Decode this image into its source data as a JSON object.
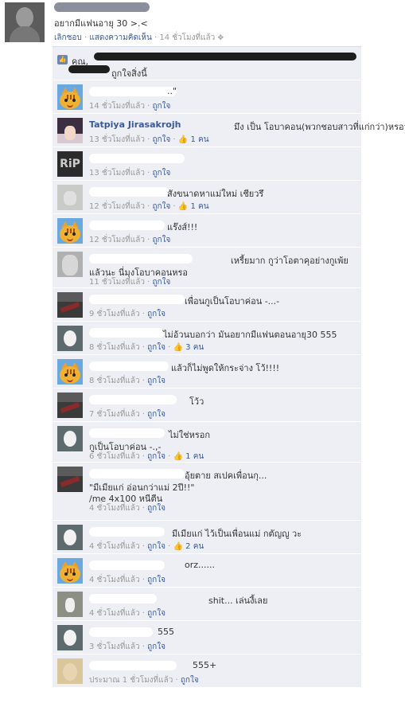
{
  "post": {
    "text": "อยากมีแฟนอายุ 30 >.<",
    "unlike": "เลิกชอบ",
    "comment": "แสดงความคิดเห็น",
    "time": "14 ชั่วโมงที่แล้ว",
    "sep": "·"
  },
  "likes": {
    "you": "คุณ,",
    "tail": "ถูกใจสิ่งนี้"
  },
  "comment_like_label": "ถูกใจ",
  "comments": [
    {
      "avatar": "cat",
      "name": "",
      "text": "..\"",
      "text2": "",
      "time": "14 ชั่วโมงที่แล้ว",
      "likes": ""
    },
    {
      "avatar": "anime",
      "name": "Tatpiya Jirasakrojh",
      "text": "มึง เป็น โอบาคอน(พวกชอบสาวที่แก่กว่า)หรอวะ",
      "text2": "",
      "time": "13 ชั่วโมงที่แล้ว",
      "likes": "1 คน"
    },
    {
      "avatar": "rip",
      "name": "",
      "text": "",
      "text2": "",
      "time": "13 ชั่วโมงที่แล้ว",
      "likes": ""
    },
    {
      "avatar": "sticker",
      "name": "",
      "text": "สังขนาดหาแม่ใหม่ เชียวรึ",
      "text2": "",
      "time": "12 ชั่วโมงที่แล้ว",
      "likes": "1 คน"
    },
    {
      "avatar": "cat",
      "name": "",
      "text": "แร๊งส์!!!",
      "text2": "",
      "time": "12 ชั่วโมงที่แล้ว",
      "likes": ""
    },
    {
      "avatar": "gray",
      "name": "",
      "text": "เหรี้ยมาก กูว่าโอตาคุอย่างกูเพ้ย",
      "text2": "แล้วนะ นี่มุงโอบาคอนหรอ",
      "time": "11 ชั่วโมงที่แล้ว",
      "likes": ""
    },
    {
      "avatar": "guitar",
      "name": "",
      "text": "เพื่อนกูเป็นโอบาค่อน -...-",
      "text2": "",
      "time": "9 ชั่วโมงที่แล้ว",
      "likes": ""
    },
    {
      "avatar": "photo",
      "name": "",
      "text": "ไม่อ้วนบอกว่า มันอยากมีแฟนตอนอายุ30 555",
      "text2": "",
      "time": "8 ชั่วโมงที่แล้ว",
      "likes": "3 คน"
    },
    {
      "avatar": "cat",
      "name": "",
      "text": "แล้วก็ไม่พูดให้กระจ่าง โว้!!!!",
      "text2": "",
      "time": "8 ชั่วโมงที่แล้ว",
      "likes": ""
    },
    {
      "avatar": "guitar",
      "name": "",
      "text": "โว้ว",
      "text2": "",
      "time": "7 ชั่วโมงที่แล้ว",
      "likes": ""
    },
    {
      "avatar": "photo",
      "name": "",
      "text": "ไม่ใช่หรอก",
      "text2": "กูเป็นโอบาค่อน -.,-",
      "time": "6 ชั่วโมงที่แล้ว",
      "likes": "1 คน"
    },
    {
      "avatar": "guitar",
      "name": "",
      "text": "อุ้ยตาย สเปคเพื่อนกุ...",
      "text2": "\"มีเมียแก่ อ่อนกว่าแม่ 2ปี!!\"",
      "text3": "/me 4x100 หนีตีน",
      "time": "4 ชั่วโมงที่แล้ว",
      "likes": ""
    },
    {
      "avatar": "photo",
      "name": "",
      "text": "มีเมียแก่ ไว้เป็นเพื่อนแม่ กตัญญู วะ",
      "text2": "",
      "time": "4 ชั่วโมงที่แล้ว",
      "likes": "2 คน"
    },
    {
      "avatar": "cat",
      "name": "",
      "text": "orz......",
      "text2": "",
      "time": "4 ชั่วโมงที่แล้ว",
      "likes": ""
    },
    {
      "avatar": "street",
      "name": "",
      "text": "shit... เล่นงี้เลย",
      "text2": "",
      "time": "4 ชั่วโมงที่แล้ว",
      "likes": ""
    },
    {
      "avatar": "photo",
      "name": "",
      "text": "555",
      "text2": "",
      "time": "3 ชั่วโมงที่แล้ว",
      "likes": ""
    },
    {
      "avatar": "blonde",
      "name": "",
      "text": "555+",
      "text2": "",
      "time": "ประมาณ 1 ชั่วโมงที่แล้ว",
      "likes": ""
    }
  ]
}
